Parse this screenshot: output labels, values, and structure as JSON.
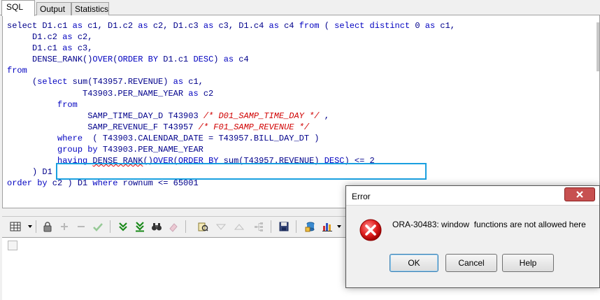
{
  "tabs": [
    {
      "label": "SQL",
      "active": true
    },
    {
      "label": "Output",
      "active": false
    },
    {
      "label": "Statistics",
      "active": false
    }
  ],
  "sql": {
    "l1a": "select D1.c1 ",
    "l1b": "as",
    "l1c": " c1, D1.c2 ",
    "l1d": "as",
    "l1e": " c2, D1.c3 ",
    "l1f": "as",
    "l1g": " c3, D1.c4 ",
    "l1h": "as",
    "l1i": " c4 ",
    "l1j": "from",
    "l1k": " ( ",
    "l1l": "select distinct",
    "l1m": " 0 ",
    "l1n": "as",
    "l1o": " c1,",
    "l2a": "     D1.c2 ",
    "l2b": "as",
    "l2c": " c2,",
    "l3a": "     D1.c1 ",
    "l3b": "as",
    "l3c": " c3,",
    "l4a": "     DENSE_RANK()",
    "l4b": "OVER",
    "l4c": "(",
    "l4d": "ORDER BY",
    "l4e": " D1.c1 ",
    "l4f": "DESC",
    "l4g": ") ",
    "l4h": "as",
    "l4i": " c4",
    "l5": "from",
    "l6a": "     (",
    "l6b": "select",
    "l6c": " sum(T43957.REVENUE) ",
    "l6d": "as",
    "l6e": " c1,",
    "l7a": "               T43903.PER_NAME_YEAR ",
    "l7b": "as",
    "l7c": " c2",
    "l8": "          from",
    "l9a": "                SAMP_TIME_DAY_D T43903 ",
    "l9b": "/* D01_SAMP_TIME_DAY */",
    "l9c": " ,",
    "l10a": "                SAMP_REVENUE_F T43957 ",
    "l10b": "/* F01_SAMP_REVENUE */",
    "l11a": "          where",
    "l11b": "  ( T43903.CALENDAR_DATE = T43957.BILL_DAY_DT )",
    "l12a": "          group by",
    "l12b": " T43903.PER_NAME_YEAR",
    "l13a": "          having",
    "l13b": " ",
    "l13c": "DENSE_RANK",
    "l13d": "()",
    "l13e": "OVER",
    "l13f": "(",
    "l13g": "ORDER BY",
    "l13h": " sum(T43957.REVENUE) ",
    "l13i": "DESC",
    "l13j": ") <= 2",
    "l14a": "     ) D1",
    "l15a": "order by",
    "l15b": " c2 ) D1 ",
    "l15c": "where",
    "l15d": " rownum <= 65001"
  },
  "dialog": {
    "title": "Error",
    "message": "ORA-30483: window  functions are not allowed here",
    "ok_label": "OK",
    "cancel_label": "Cancel",
    "help_label": "Help"
  },
  "colors": {
    "highlight_box": "#1aa0e0",
    "keyword": "#0000c0",
    "comment": "#d00000",
    "close_button": "#c75050"
  },
  "toolbar_icons": [
    "grid-view-icon",
    "lock-icon",
    "add-row-icon",
    "delete-row-icon",
    "commit-check-icon",
    "fetch-next-icon",
    "fetch-all-icon",
    "find-binoculars-icon",
    "clear-eraser-icon",
    "query-by-example-icon",
    "filter-down-icon",
    "filter-up-icon",
    "tree-icon",
    "save-icon",
    "export-icon",
    "chart-icon"
  ]
}
